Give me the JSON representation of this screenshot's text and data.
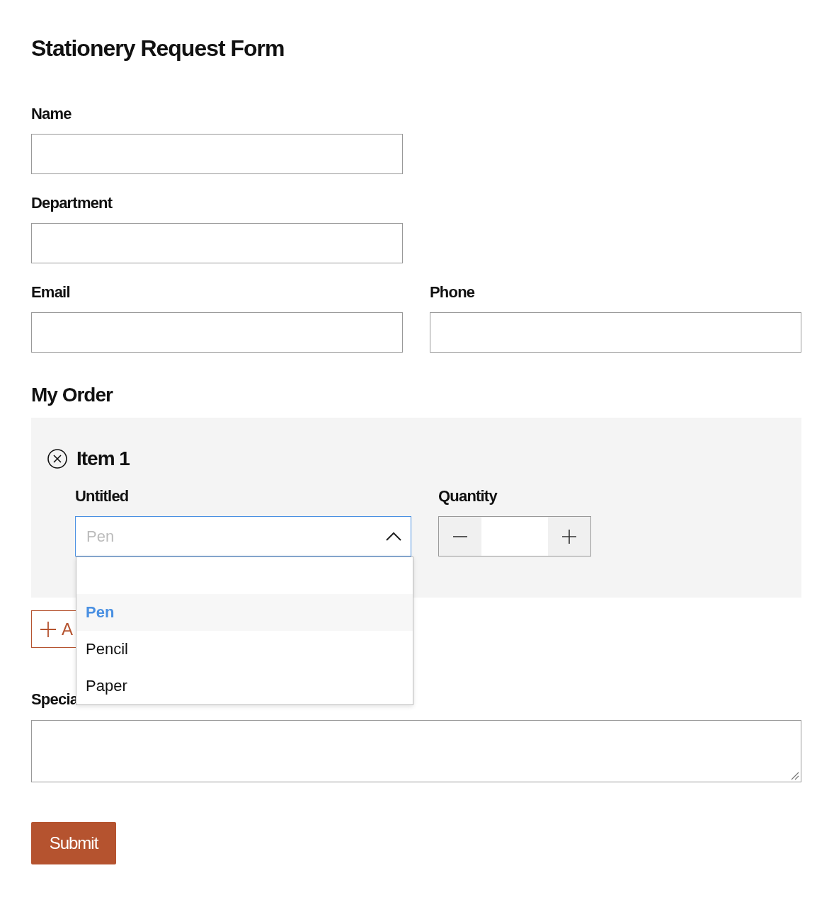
{
  "title": "Stationery Request Form",
  "fields": [
    {
      "label": "Name"
    },
    {
      "label": "Department"
    }
  ],
  "contact": [
    {
      "label": "Email"
    },
    {
      "label": "Phone"
    }
  ],
  "order": {
    "heading": "My Order",
    "items": [
      {
        "title": "Item 1",
        "product_label": "Untitled",
        "placeholder": "Pen",
        "expanded": true,
        "quantity_label": "Quantity",
        "options": [
          {
            "kind": "option",
            "label": "Pen",
            "selected": true
          },
          {
            "kind": "option",
            "label": "Pencil",
            "selected": false
          },
          {
            "kind": "option",
            "label": "Paper",
            "selected": false
          }
        ]
      }
    ],
    "add_button": "A"
  },
  "special_label": "Specia",
  "submit": "Submit"
}
